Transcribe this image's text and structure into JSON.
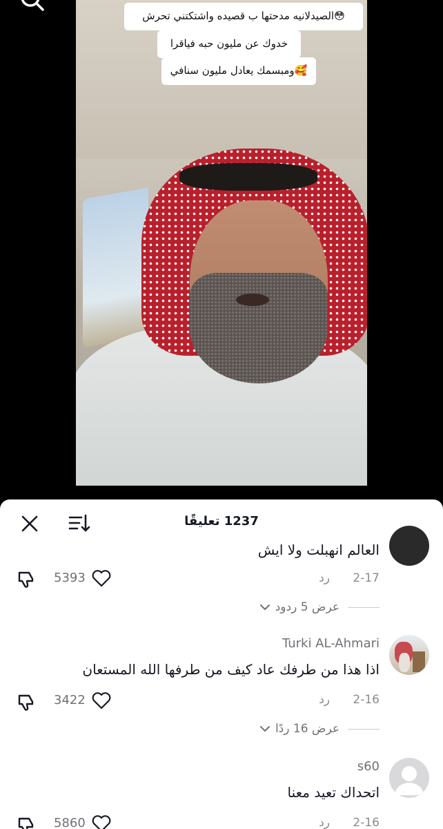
{
  "video": {
    "caption_lines": [
      "الصيدلانيه مدحتها ب قصيده واشتكتني تحرش😳",
      "خدوك عن مليون حبه فياقرا",
      "ومبسمك يعادل مليون سنافي🥰"
    ]
  },
  "sheet": {
    "count_label": "1237 تعليقًا"
  },
  "comments": [
    {
      "text": "العالم انهبلت ولا ايش",
      "date": "2-17",
      "reply_label": "رد",
      "likes": "5393",
      "view_replies": "عرض 5 ردود"
    },
    {
      "username": "Turki AL-Ahmari",
      "text": "اذا هذا من طرفك عاد كيف من طرفها الله المستعان",
      "date": "2-16",
      "reply_label": "رد",
      "likes": "3422",
      "view_replies": "عرض 16 ردًا"
    },
    {
      "username": "s60",
      "text": "اتحداك تعيد معنا",
      "date": "2-16",
      "reply_label": "رد",
      "likes": "5860"
    }
  ],
  "icons": {
    "search": "search-icon",
    "close": "close-icon",
    "sort": "sort-icon",
    "heart": "heart-icon",
    "dislike": "dislike-icon",
    "chevron": "chevron-down-icon",
    "default_avatar": "default-avatar-icon"
  },
  "colors": {
    "sheet_bg": "#ffffff",
    "text_primary": "#161823",
    "text_secondary": "#8a8b91"
  }
}
